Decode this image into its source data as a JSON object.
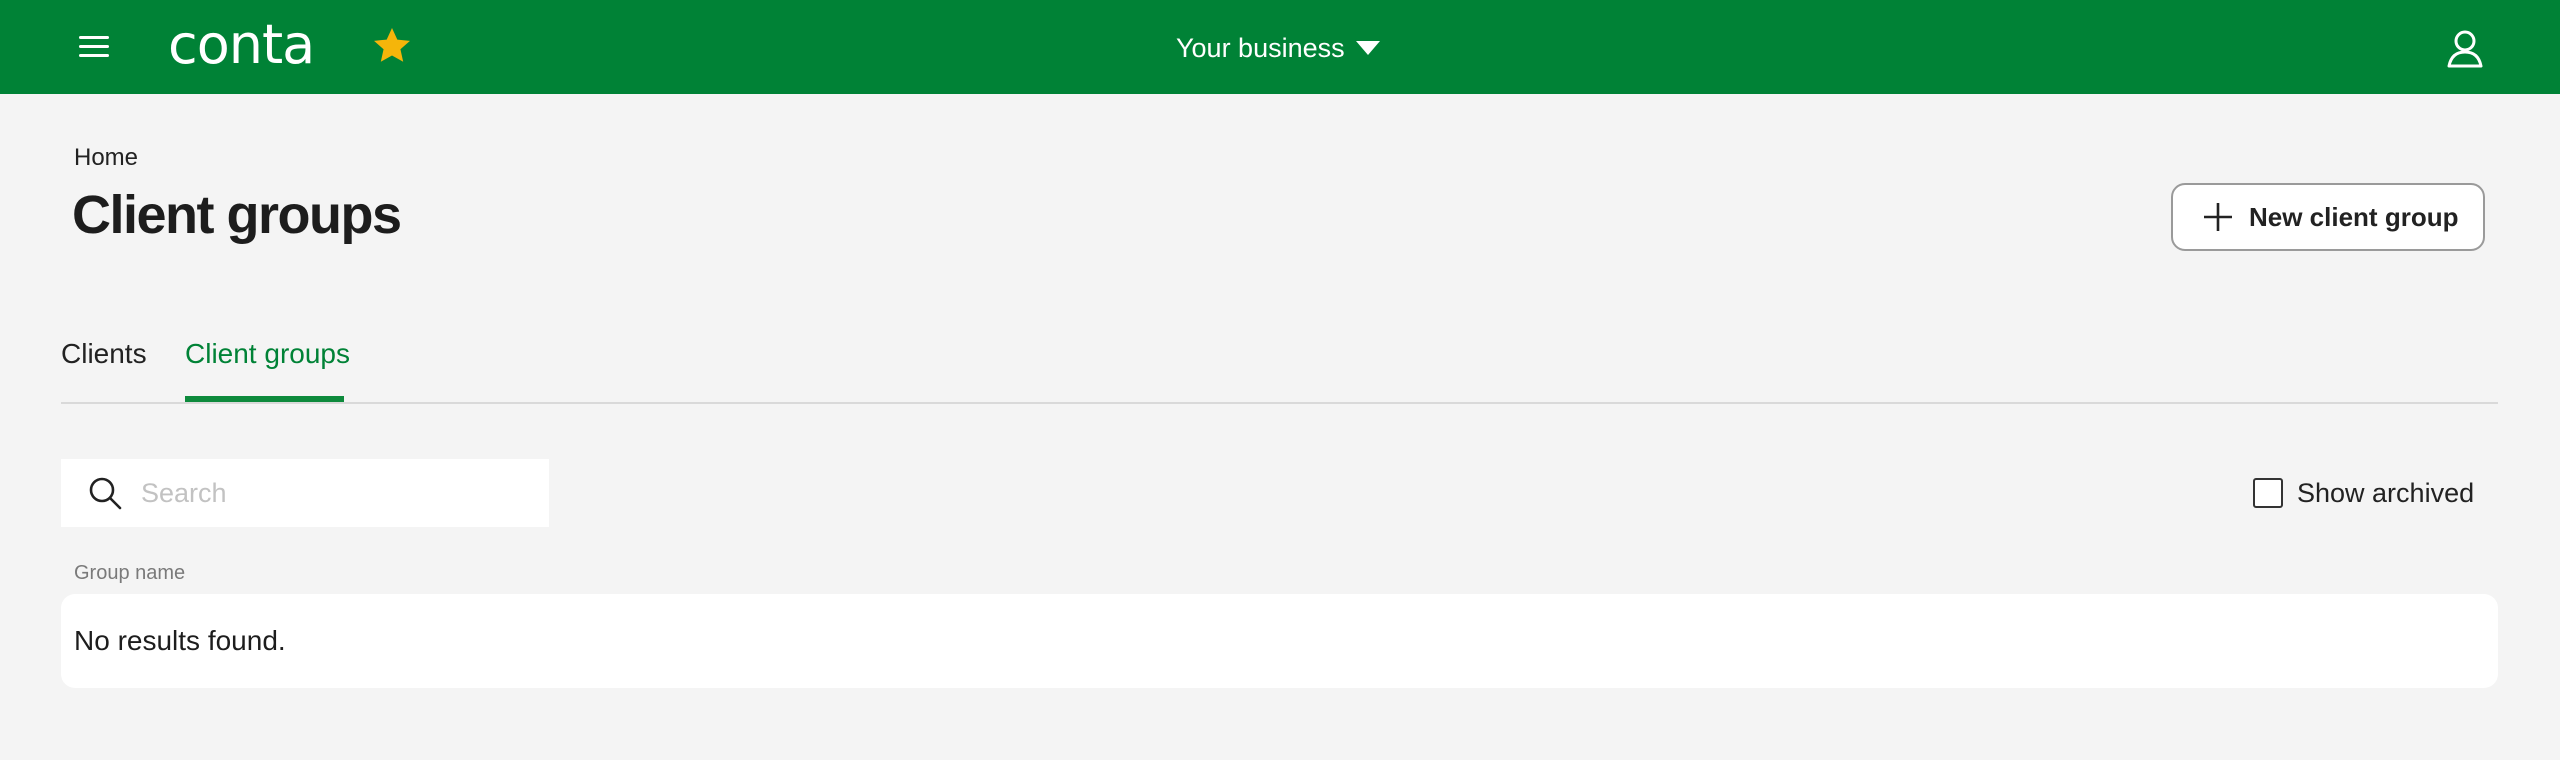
{
  "colors": {
    "brand_green": "#008236",
    "star_yellow": "#f5b50a",
    "background": "#f4f4f4"
  },
  "topbar": {
    "menu_icon": "hamburger-menu-icon",
    "logo_text": "conta",
    "favorite_icon": "star-icon",
    "business_label": "Your business",
    "business_icon": "caret-down-icon",
    "user_icon": "user-icon"
  },
  "breadcrumb": {
    "home": "Home"
  },
  "page": {
    "title": "Client groups",
    "new_button_label": "New client group",
    "new_button_icon": "plus-icon"
  },
  "tabs": [
    {
      "label": "Clients",
      "active": false
    },
    {
      "label": "Client groups",
      "active": true
    }
  ],
  "search": {
    "placeholder": "Search",
    "value": "",
    "icon": "search-icon"
  },
  "filters": {
    "show_archived_label": "Show archived",
    "show_archived_checked": false
  },
  "table": {
    "column_header": "Group name",
    "empty_message": "No results found."
  }
}
